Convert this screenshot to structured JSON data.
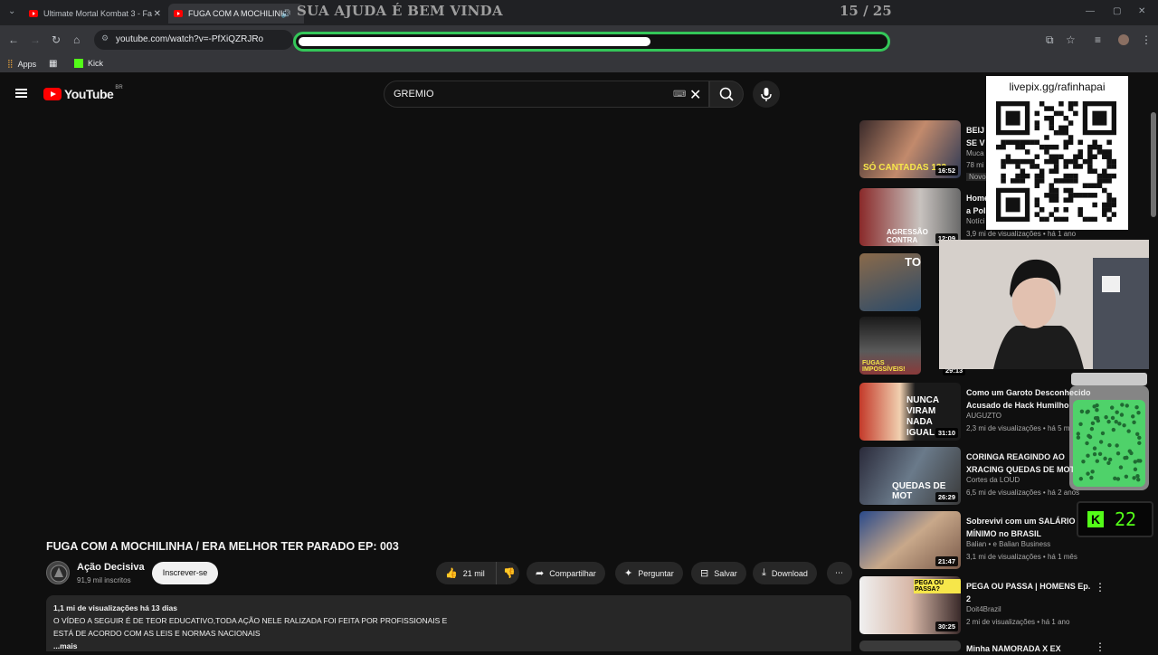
{
  "browser": {
    "tabs": [
      {
        "label": "Ultimate Mortal Kombat 3 - Fa"
      },
      {
        "label": "FUGA COM A MOCHILINH"
      }
    ],
    "url": "youtube.com/watch?v=-PfXiQZRJRo",
    "bookmarks": [
      {
        "label": "Apps"
      },
      {
        "label": "Kick"
      }
    ]
  },
  "stream_overlay": {
    "goal_title": "SUA AJUDA É BEM VINDA",
    "goal_counter": "15 / 25",
    "goal_progress": 0.6,
    "qr_label": "livepix.gg/rafinhapai",
    "kick_viewers": "22",
    "kick_logo": "K",
    "accent": "#34c759"
  },
  "youtube": {
    "logo": "YouTube",
    "region": "BR",
    "search_value": "GREMIO",
    "video": {
      "title": "FUGA COM A MOCHILINHA / ERA MELHOR TER PARADO EP: 003",
      "channel": "Ação Decisiva",
      "subscribers": "91,9 mil inscritos",
      "subscribe_label": "Inscrever-se",
      "likes": "21 mil",
      "share_label": "Compartilhar",
      "ask_label": "Perguntar",
      "save_label": "Salvar",
      "download_label": "Download",
      "desc_stats": "1,1 mi de visualizações  há 13 dias",
      "desc_line1": "O VÍDEO A SEGUIR É DE TEOR EDUCATIVO,TODA AÇÃO NELE RALIZADA FOI FEITA POR PROFISSIONAIS E",
      "desc_line2": "ESTÁ DE ACORDO COM AS LEIS E NORMAS NACIONAIS",
      "desc_more": "...mais"
    },
    "recommendations": [
      {
        "title": "BEIJ\nSE V",
        "channel": "Muca",
        "meta": "78 mi",
        "badge": "Novo",
        "duration": "16:52",
        "thumb_text": "SÓ CANTADAS 122"
      },
      {
        "title": "Home\na Pol",
        "channel": "Notíci",
        "meta": "3,9 mi de visualizações • há 1 ano",
        "duration": "12:09",
        "thumb_text": "AGRESSÃO CONTRA"
      },
      {
        "title": "",
        "channel": "",
        "meta": "",
        "duration": "",
        "thumb_text": "TO"
      },
      {
        "title": "",
        "channel": "",
        "meta": "",
        "duration": "29:13",
        "thumb_text": "FUGAS IMPOSSÍVEIS!"
      },
      {
        "title": "Como um Garoto Desconhecido\nAcusado de Hack Humilho",
        "channel": "AUGUZTO",
        "meta": "2,3 mi de visualizações • há 5 m",
        "duration": "31:10",
        "thumb_text": "NUNCA VIRAM NADA IGUAL"
      },
      {
        "title": "CORINGA REAGINDO AO\nXRACING QUEDAS DE MOT",
        "channel": "Cortes da LOUD",
        "meta": "6,5 mi de visualizações • há 2 anos",
        "duration": "26:29",
        "thumb_text": "QUEDAS DE MOT"
      },
      {
        "title": "Sobrevivi com um SALÁRIO\nMÍNIMO no BRASIL",
        "channel": "Balian • e Balian Business",
        "meta": "3,1 mi de visualizações • há 1 mês",
        "duration": "21:47",
        "thumb_text": ""
      },
      {
        "title": "PEGA OU PASSA | HOMENS Ep.\n2",
        "channel": "Doit4Brazil",
        "meta": "2 mi de visualizações • há 1 ano",
        "duration": "30:25",
        "thumb_text": "PEGA OU PASSA?"
      },
      {
        "title": "Minha NAMORADA X EX",
        "channel": "",
        "meta": "",
        "duration": "",
        "thumb_text": ""
      }
    ]
  }
}
